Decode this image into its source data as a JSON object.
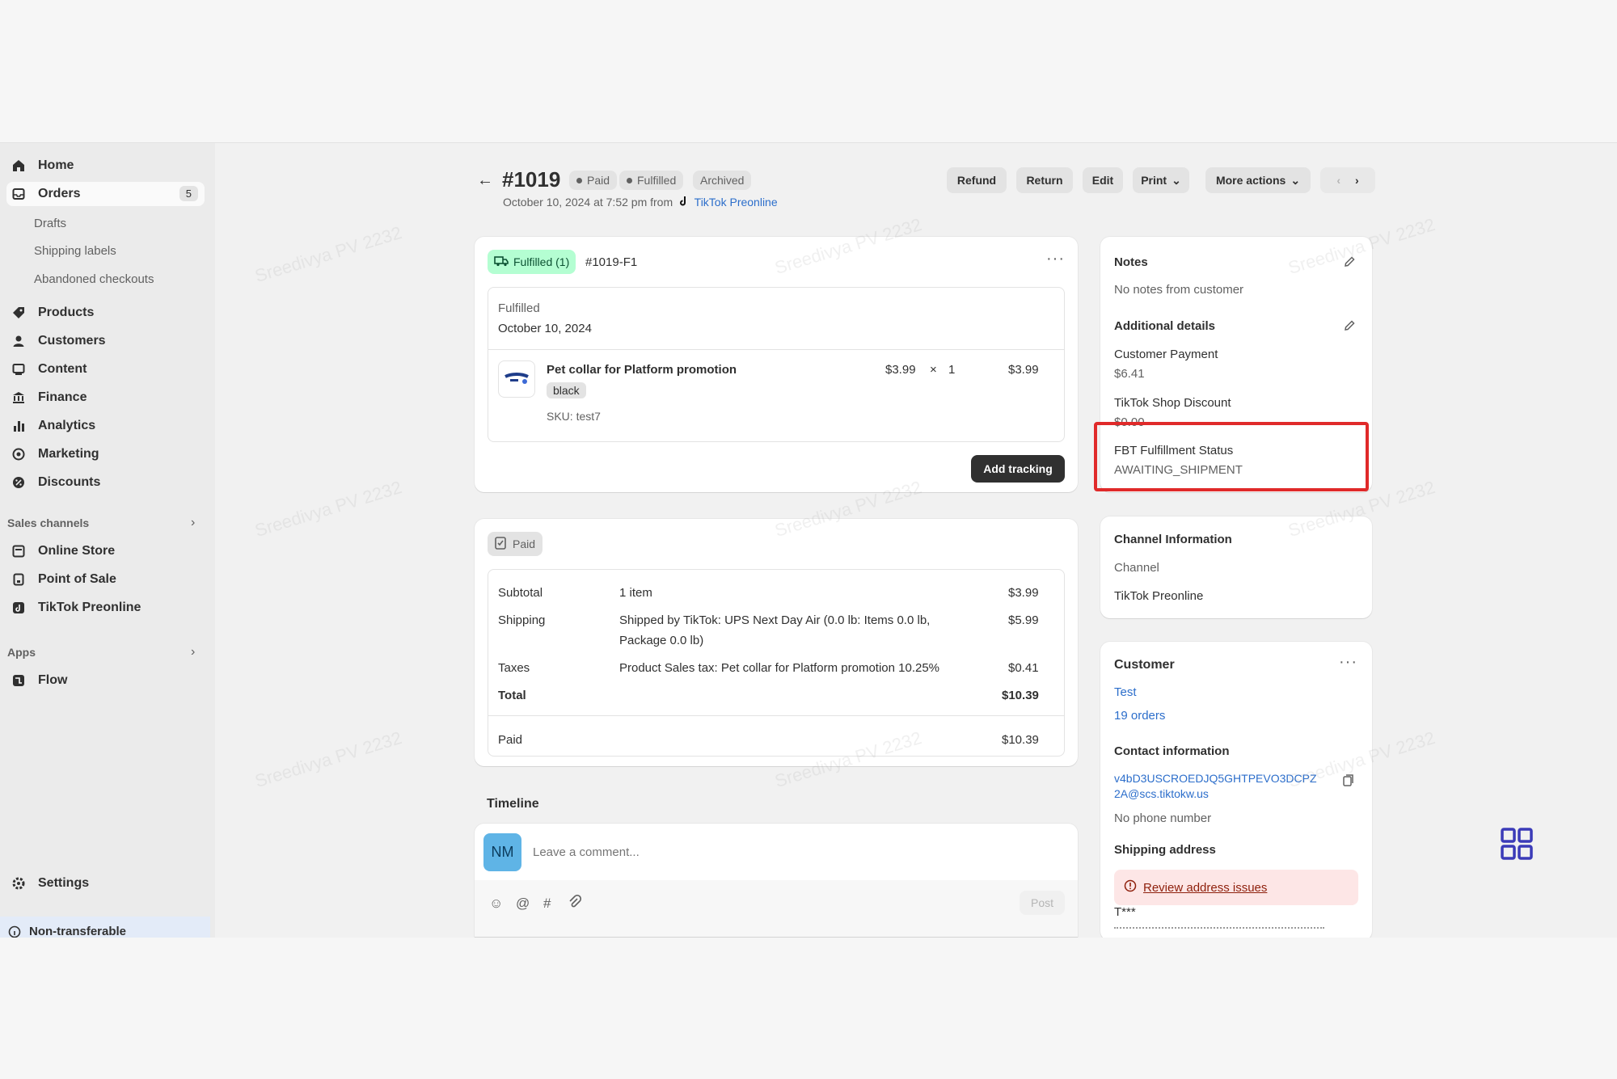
{
  "sidebar": {
    "items": [
      {
        "label": "Home",
        "icon": "home-icon"
      },
      {
        "label": "Orders",
        "icon": "orders-icon",
        "count": "5"
      },
      {
        "label": "Products",
        "icon": "tag-icon"
      },
      {
        "label": "Customers",
        "icon": "person-icon"
      },
      {
        "label": "Content",
        "icon": "content-icon"
      },
      {
        "label": "Finance",
        "icon": "bank-icon"
      },
      {
        "label": "Analytics",
        "icon": "bar-chart-icon"
      },
      {
        "label": "Marketing",
        "icon": "target-icon"
      },
      {
        "label": "Discounts",
        "icon": "discount-icon"
      }
    ],
    "order_subitems": [
      "Drafts",
      "Shipping labels",
      "Abandoned checkouts"
    ],
    "sales_channels_title": "Sales channels",
    "channels": [
      "Online Store",
      "Point of Sale",
      "TikTok Preonline"
    ],
    "apps_title": "Apps",
    "apps": [
      "Flow"
    ],
    "settings": "Settings",
    "non_transferable": "Non-transferable"
  },
  "header": {
    "order_number": "#1019",
    "badges": [
      "Paid",
      "Fulfilled",
      "Archived"
    ],
    "date_text": "October 10, 2024 at 7:52 pm from",
    "source": "TikTok Preonline",
    "buttons": [
      "Refund",
      "Return",
      "Edit",
      "Print",
      "More actions"
    ]
  },
  "fulfillment": {
    "status_tag": "Fulfilled (1)",
    "fulfillment_id": "#1019-F1",
    "status": "Fulfilled",
    "date": "October 10, 2024",
    "product_name": "Pet collar for Platform promotion",
    "variant": "black",
    "sku": "SKU: test7",
    "unit_price": "$3.99",
    "times": "×",
    "qty": "1",
    "line_total": "$3.99",
    "add_tracking": "Add tracking"
  },
  "payment": {
    "badge": "Paid",
    "rows": [
      {
        "label": "Subtotal",
        "desc": "1 item",
        "amount": "$3.99"
      },
      {
        "label": "Shipping",
        "desc": "Shipped by TikTok: UPS Next Day Air (0.0 lb: Items 0.0 lb,",
        "desc2": "Package 0.0 lb)",
        "amount": "$5.99"
      },
      {
        "label": "Taxes",
        "desc": "Product Sales tax: Pet collar for Platform promotion 10.25%",
        "amount": "$0.41"
      },
      {
        "label": "Total",
        "desc": "",
        "amount": "$10.39"
      }
    ],
    "paid_label": "Paid",
    "paid_amount": "$10.39"
  },
  "timeline": {
    "title": "Timeline",
    "avatar": "NM",
    "placeholder": "Leave a comment...",
    "post": "Post"
  },
  "notes": {
    "title": "Notes",
    "text": "No notes from customer",
    "additional_title": "Additional details",
    "details": [
      {
        "label": "Customer Payment",
        "value": "$6.41"
      },
      {
        "label": "TikTok Shop Discount",
        "value": "$0.00"
      },
      {
        "label": "FBT Fulfillment Status",
        "value": "AWAITING_SHIPMENT"
      }
    ]
  },
  "channel_info": {
    "title": "Channel Information",
    "label": "Channel",
    "value": "TikTok Preonline"
  },
  "customer": {
    "title": "Customer",
    "name": "Test",
    "orders": "19 orders",
    "contact_title": "Contact information",
    "email_line1": "v4bD3USCROEDJQ5GHTPEVO3DCPZ",
    "email_line2": "2A@scs.tiktokw.us",
    "phone": "No phone number",
    "shipping_title": "Shipping address",
    "alert": "Review address issues",
    "address_start": "T***"
  },
  "watermark": "Sreedivya PV 2232",
  "colors": {
    "accent_blue": "#2c6ecb",
    "highlight_red": "#e02a2a",
    "fulfilled_green": "#b4fed2"
  }
}
